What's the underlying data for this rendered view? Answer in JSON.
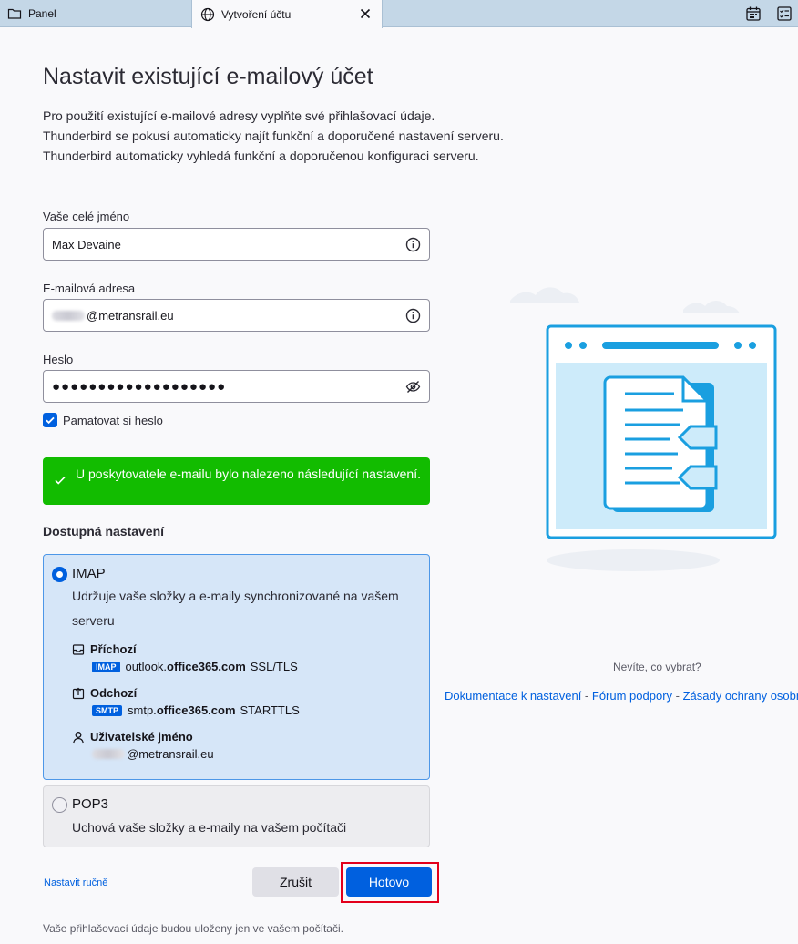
{
  "tabs": {
    "panel_label": "Panel",
    "active_label": "Vytvoření účtu"
  },
  "title": "Nastavit existující e-mailový účet",
  "intro": [
    "Pro použití existující e-mailové adresy vyplňte své přihlašovací údaje.",
    "Thunderbird se pokusí automaticky najít funkční a doporučené nastavení serveru.",
    "Thunderbird automaticky vyhledá funkční a doporučenou konfiguraci serveru."
  ],
  "form": {
    "name_label": "Vaše celé jméno",
    "name_value": "Max Devaine",
    "email_label": "E-mailová adresa",
    "email_domain": "@metransrail.eu",
    "password_label": "Heslo",
    "password_value": "●●●●●●●●●●●●●●●●●●●",
    "remember_label": "Pamatovat si heslo"
  },
  "success_message": "U poskytovatele e-mailu bylo nalezeno následující nastavení.",
  "available_heading": "Dostupná nastavení",
  "imap": {
    "title": "IMAP",
    "description": "Udržuje vaše složky a e-maily synchronizované na vašem serveru",
    "incoming_label": "Příchozí",
    "incoming_badge": "IMAP",
    "incoming_host_prefix": "outlook.",
    "incoming_host_bold": "office365.com",
    "incoming_security": "SSL/TLS",
    "outgoing_label": "Odchozí",
    "outgoing_badge": "SMTP",
    "outgoing_host_prefix": "smtp.",
    "outgoing_host_bold": "office365.com",
    "outgoing_security": "STARTTLS",
    "username_label": "Uživatelské jméno",
    "username_domain": "@metransrail.eu"
  },
  "pop3": {
    "title": "POP3",
    "description": "Uchová vaše složky a e-maily na vašem počítači"
  },
  "actions": {
    "manual_label": "Nastavit ručně",
    "cancel_label": "Zrušit",
    "done_label": "Hotovo"
  },
  "footer_note": "Vaše přihlašovací údaje budou uloženy jen ve vašem počítači.",
  "help": {
    "question": "Nevíte, co vybrat?",
    "doc_link": "Dokumentace k nastavení",
    "forum_link": "Fórum podpory",
    "privacy_link": "Zásady ochrany osobních údajů",
    "separator": " - "
  },
  "colors": {
    "accent": "#0060df",
    "success": "#12bc00",
    "highlight": "#e3001b",
    "illustration": "#1a9fe0"
  }
}
